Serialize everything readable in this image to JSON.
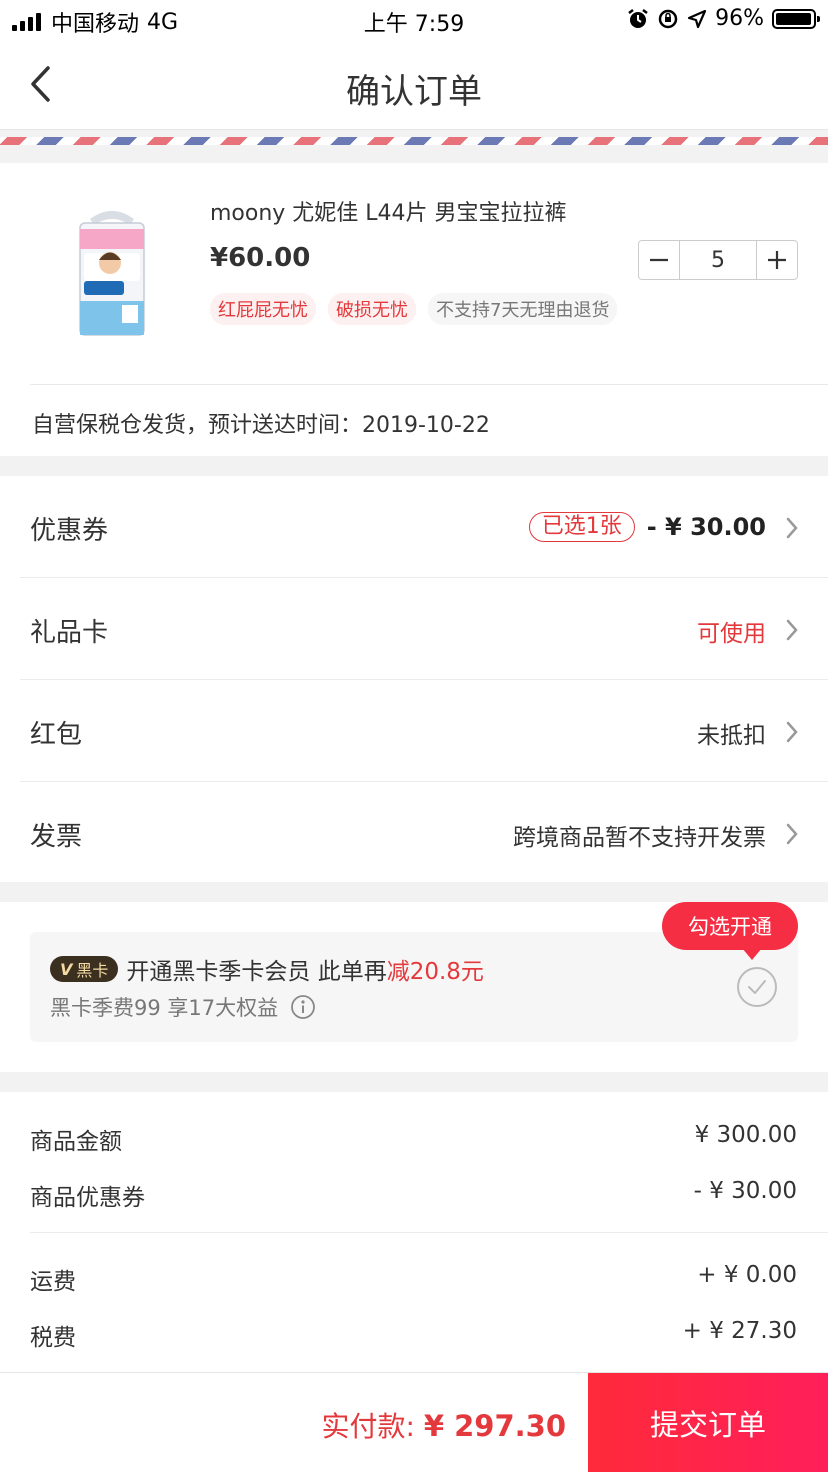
{
  "status_bar": {
    "carrier": "中国移动",
    "network": "4G",
    "time": "上午 7:59",
    "battery": "96%",
    "battery_level": 0.96
  },
  "nav": {
    "title": "确认订单",
    "back_icon": "chevron-left-icon"
  },
  "product": {
    "name": "moony 尤妮佳 L44片 男宝宝拉拉裤",
    "price": "¥60.00",
    "quantity": "5",
    "tags": [
      {
        "label": "红屁屁无忧",
        "style": "red"
      },
      {
        "label": "破损无忧",
        "style": "red"
      },
      {
        "label": "不支持7天无理由退货",
        "style": "gray"
      }
    ],
    "delivery": "自营保税仓发货，预计送达时间：2019-10-22"
  },
  "options": [
    {
      "label": "优惠券",
      "badge": "已选1张",
      "value": "- ¥ 30.00"
    },
    {
      "label": "礼品卡",
      "value": "可使用"
    },
    {
      "label": "红包",
      "value": "未抵扣"
    },
    {
      "label": "发票",
      "value": "跨境商品暂不支持开发票"
    }
  ],
  "black_card": {
    "badge_v": "V",
    "badge_text": "黑卡",
    "title": "开通黑卡季卡会员 此单再",
    "highlight": "减20.8元",
    "subtitle": "黑卡季费99 享17大权益",
    "bubble": "勾选开通"
  },
  "summary": [
    {
      "label": "商品金额",
      "value": "¥ 300.00"
    },
    {
      "label": "商品优惠券",
      "value": "- ¥ 30.00"
    },
    {
      "label": "运费",
      "value": "+ ¥ 0.00"
    },
    {
      "label": "税费",
      "value": "+ ¥ 27.30"
    }
  ],
  "footer": {
    "pay_label": "实付款:",
    "pay_amount": "¥ 297.30",
    "submit": "提交订单"
  },
  "colors": {
    "accent_red": "#e4393c",
    "submit_red": "#ff2a3a",
    "black_card_brown": "#3b2f1f"
  }
}
